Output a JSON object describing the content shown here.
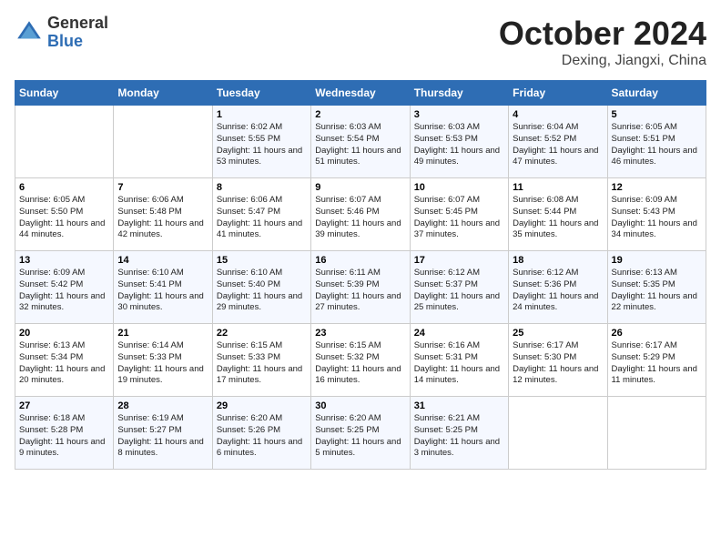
{
  "logo": {
    "general": "General",
    "blue": "Blue"
  },
  "title": "October 2024",
  "location": "Dexing, Jiangxi, China",
  "days_of_week": [
    "Sunday",
    "Monday",
    "Tuesday",
    "Wednesday",
    "Thursday",
    "Friday",
    "Saturday"
  ],
  "weeks": [
    [
      {
        "day": "",
        "info": ""
      },
      {
        "day": "",
        "info": ""
      },
      {
        "day": "1",
        "info": "Sunrise: 6:02 AM\nSunset: 5:55 PM\nDaylight: 11 hours and 53 minutes."
      },
      {
        "day": "2",
        "info": "Sunrise: 6:03 AM\nSunset: 5:54 PM\nDaylight: 11 hours and 51 minutes."
      },
      {
        "day": "3",
        "info": "Sunrise: 6:03 AM\nSunset: 5:53 PM\nDaylight: 11 hours and 49 minutes."
      },
      {
        "day": "4",
        "info": "Sunrise: 6:04 AM\nSunset: 5:52 PM\nDaylight: 11 hours and 47 minutes."
      },
      {
        "day": "5",
        "info": "Sunrise: 6:05 AM\nSunset: 5:51 PM\nDaylight: 11 hours and 46 minutes."
      }
    ],
    [
      {
        "day": "6",
        "info": "Sunrise: 6:05 AM\nSunset: 5:50 PM\nDaylight: 11 hours and 44 minutes."
      },
      {
        "day": "7",
        "info": "Sunrise: 6:06 AM\nSunset: 5:48 PM\nDaylight: 11 hours and 42 minutes."
      },
      {
        "day": "8",
        "info": "Sunrise: 6:06 AM\nSunset: 5:47 PM\nDaylight: 11 hours and 41 minutes."
      },
      {
        "day": "9",
        "info": "Sunrise: 6:07 AM\nSunset: 5:46 PM\nDaylight: 11 hours and 39 minutes."
      },
      {
        "day": "10",
        "info": "Sunrise: 6:07 AM\nSunset: 5:45 PM\nDaylight: 11 hours and 37 minutes."
      },
      {
        "day": "11",
        "info": "Sunrise: 6:08 AM\nSunset: 5:44 PM\nDaylight: 11 hours and 35 minutes."
      },
      {
        "day": "12",
        "info": "Sunrise: 6:09 AM\nSunset: 5:43 PM\nDaylight: 11 hours and 34 minutes."
      }
    ],
    [
      {
        "day": "13",
        "info": "Sunrise: 6:09 AM\nSunset: 5:42 PM\nDaylight: 11 hours and 32 minutes."
      },
      {
        "day": "14",
        "info": "Sunrise: 6:10 AM\nSunset: 5:41 PM\nDaylight: 11 hours and 30 minutes."
      },
      {
        "day": "15",
        "info": "Sunrise: 6:10 AM\nSunset: 5:40 PM\nDaylight: 11 hours and 29 minutes."
      },
      {
        "day": "16",
        "info": "Sunrise: 6:11 AM\nSunset: 5:39 PM\nDaylight: 11 hours and 27 minutes."
      },
      {
        "day": "17",
        "info": "Sunrise: 6:12 AM\nSunset: 5:37 PM\nDaylight: 11 hours and 25 minutes."
      },
      {
        "day": "18",
        "info": "Sunrise: 6:12 AM\nSunset: 5:36 PM\nDaylight: 11 hours and 24 minutes."
      },
      {
        "day": "19",
        "info": "Sunrise: 6:13 AM\nSunset: 5:35 PM\nDaylight: 11 hours and 22 minutes."
      }
    ],
    [
      {
        "day": "20",
        "info": "Sunrise: 6:13 AM\nSunset: 5:34 PM\nDaylight: 11 hours and 20 minutes."
      },
      {
        "day": "21",
        "info": "Sunrise: 6:14 AM\nSunset: 5:33 PM\nDaylight: 11 hours and 19 minutes."
      },
      {
        "day": "22",
        "info": "Sunrise: 6:15 AM\nSunset: 5:33 PM\nDaylight: 11 hours and 17 minutes."
      },
      {
        "day": "23",
        "info": "Sunrise: 6:15 AM\nSunset: 5:32 PM\nDaylight: 11 hours and 16 minutes."
      },
      {
        "day": "24",
        "info": "Sunrise: 6:16 AM\nSunset: 5:31 PM\nDaylight: 11 hours and 14 minutes."
      },
      {
        "day": "25",
        "info": "Sunrise: 6:17 AM\nSunset: 5:30 PM\nDaylight: 11 hours and 12 minutes."
      },
      {
        "day": "26",
        "info": "Sunrise: 6:17 AM\nSunset: 5:29 PM\nDaylight: 11 hours and 11 minutes."
      }
    ],
    [
      {
        "day": "27",
        "info": "Sunrise: 6:18 AM\nSunset: 5:28 PM\nDaylight: 11 hours and 9 minutes."
      },
      {
        "day": "28",
        "info": "Sunrise: 6:19 AM\nSunset: 5:27 PM\nDaylight: 11 hours and 8 minutes."
      },
      {
        "day": "29",
        "info": "Sunrise: 6:20 AM\nSunset: 5:26 PM\nDaylight: 11 hours and 6 minutes."
      },
      {
        "day": "30",
        "info": "Sunrise: 6:20 AM\nSunset: 5:25 PM\nDaylight: 11 hours and 5 minutes."
      },
      {
        "day": "31",
        "info": "Sunrise: 6:21 AM\nSunset: 5:25 PM\nDaylight: 11 hours and 3 minutes."
      },
      {
        "day": "",
        "info": ""
      },
      {
        "day": "",
        "info": ""
      }
    ]
  ]
}
